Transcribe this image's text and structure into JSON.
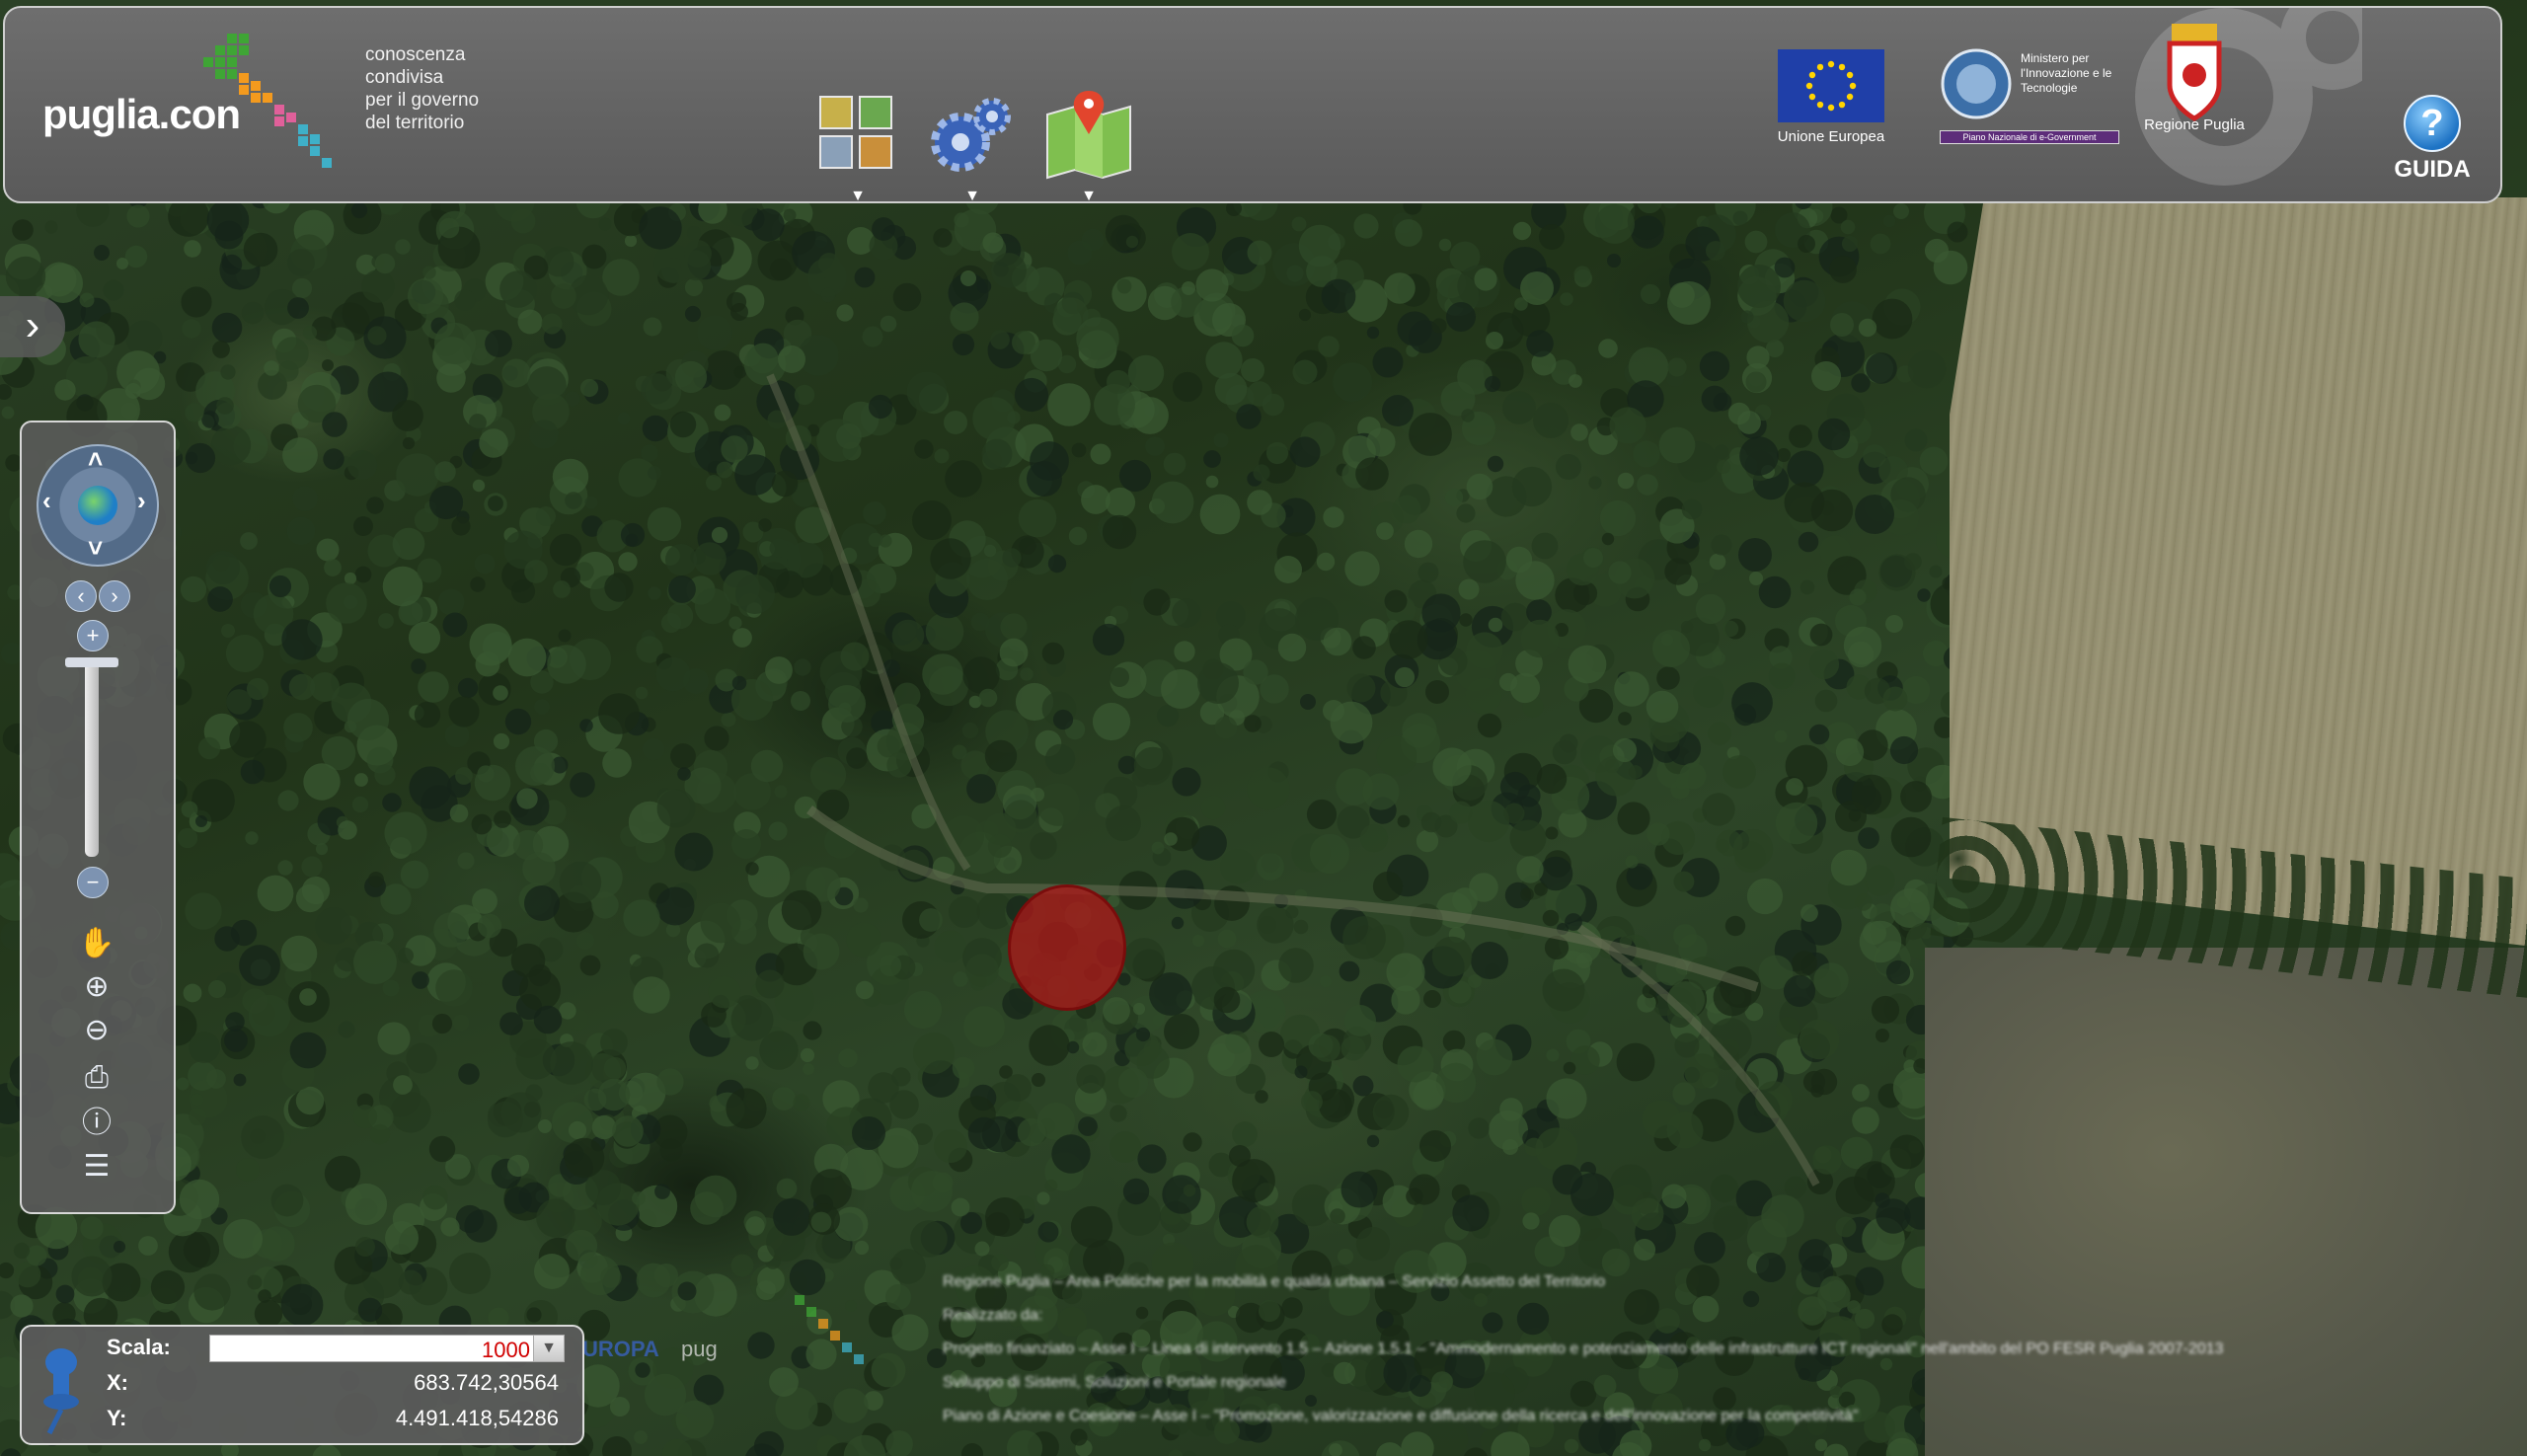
{
  "header": {
    "logo_text": "puglia.con",
    "tagline": [
      "conoscenza",
      "condivisa",
      "per il governo",
      "del territorio"
    ],
    "tools": [
      {
        "name": "basemap-layers",
        "dropdown_symbol": "▼"
      },
      {
        "name": "settings-gears",
        "dropdown_symbol": "▼"
      },
      {
        "name": "map-locator",
        "dropdown_symbol": "▼"
      }
    ],
    "partners": [
      {
        "label": "Unione Europea"
      },
      {
        "label": "Ministero per l'Innovazione e le Tecnologie",
        "sublabel": "Piano Nazionale di e-Government"
      },
      {
        "label": "Regione Puglia"
      }
    ],
    "help_label": "GUIDA",
    "help_symbol": "?"
  },
  "sidebar": {
    "expand_symbol": "›"
  },
  "navigation": {
    "zoom_in": "+",
    "zoom_out": "−",
    "tools": [
      "pan-hand-icon",
      "zoom-in-box-icon",
      "zoom-out-box-icon",
      "print-icon",
      "info-icon",
      "legend-icon"
    ]
  },
  "coordinates": {
    "scale_label": "Scala:",
    "scale_value": "1000",
    "x_label": "X:",
    "x_value": "683.742,30564",
    "y_label": "Y:",
    "y_value": "4.491.418,54286"
  },
  "map": {
    "marker_color": "#aa1919"
  },
  "credits": [
    "Regione Puglia – Area Politiche per la mobilità e qualità urbana – Servizio Assetto del Territorio",
    "Realizzato da:",
    "Progetto finanziato – Asse I – Linea di intervento 1.5 – Azione 1.5.1 – \"Ammodernamento e potenziamento delle infrastrutture ICT regionali\" nell'ambito del PO FESR Puglia 2007-2013",
    "Sviluppo di Sistemi, Soluzioni e Portale regionale",
    "Piano di Azione e Coesione – Asse I – \"Promozione, valorizzazione e diffusione della ricerca e dell'innovazione per la competitività\""
  ]
}
